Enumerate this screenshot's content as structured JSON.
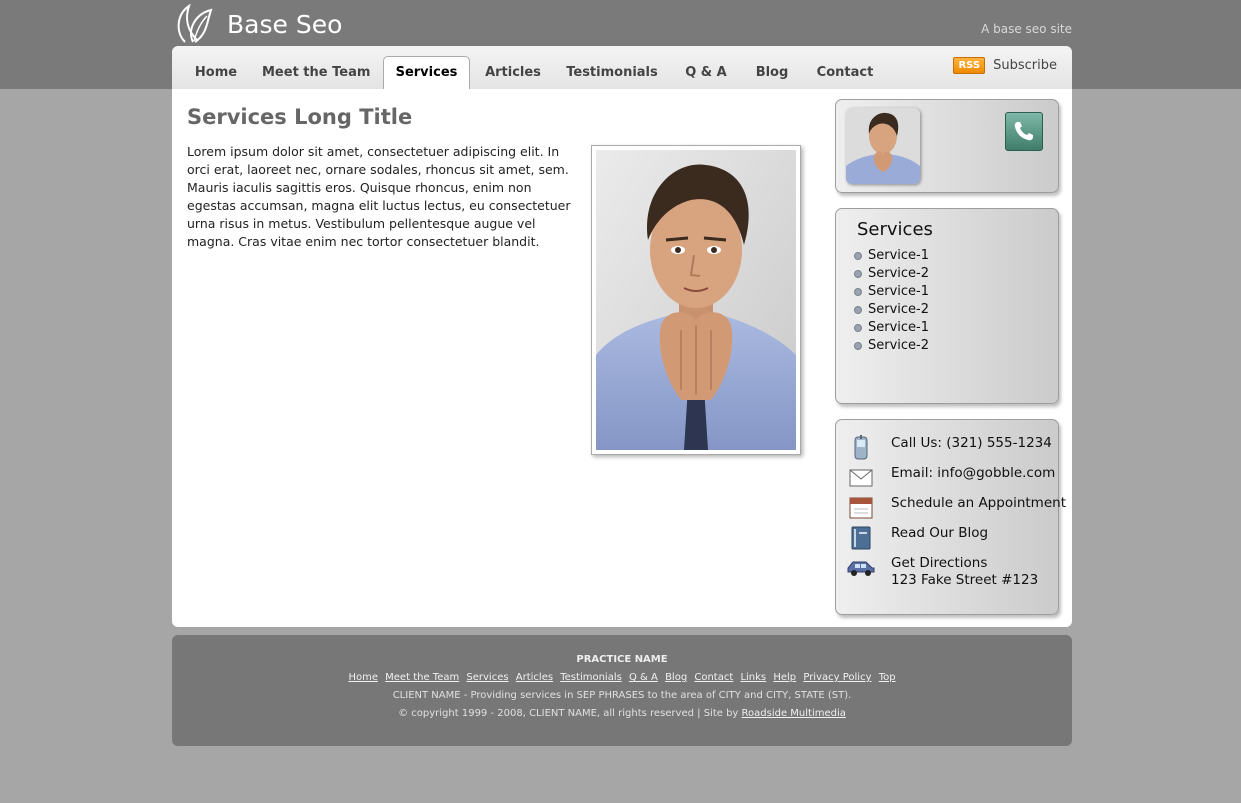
{
  "site": {
    "name": "Base Seo",
    "tagline": "A base seo site"
  },
  "nav": {
    "tabs": [
      {
        "label": "Home"
      },
      {
        "label": "Meet the Team"
      },
      {
        "label": "Services",
        "active": true
      },
      {
        "label": "Articles"
      },
      {
        "label": "Testimonials"
      },
      {
        "label": "Q & A"
      },
      {
        "label": "Blog"
      },
      {
        "label": "Contact"
      }
    ],
    "rss_badge": "RSS",
    "subscribe_label": "Subscribe"
  },
  "main": {
    "title": "Services Long Title",
    "body": "Lorem ipsum dolor sit amet, consectetuer adipiscing elit. In orci erat, laoreet nec, ornare sodales, rhoncus sit amet, sem. Mauris iaculis sagittis eros. Quisque rhoncus, enim non egestas accumsan, magna elit luctus lectus, eu consectetuer urna risus in metus. Vestibulum pellentesque augue vel magna. Cras vitae enim nec tortor consectetuer blandit."
  },
  "sidebar": {
    "services_title": "Services",
    "services": [
      "Service-1",
      "Service-2",
      "Service-1",
      "Service-2",
      "Service-1",
      "Service-2"
    ],
    "contact": {
      "call": "Call Us: (321) 555-1234",
      "email": "Email: info@gobble.com",
      "schedule": "Schedule an Appointment",
      "blog": "Read Our Blog",
      "directions": "Get Directions",
      "address": "123 Fake Street #123"
    }
  },
  "footer": {
    "practice_name": "PRACTICE NAME",
    "links": [
      "Home",
      "Meet the Team",
      "Services",
      "Articles",
      "Testimonials",
      "Q & A",
      "Blog",
      "Contact",
      "Links",
      "Help",
      "Privacy Policy",
      "Top"
    ],
    "line1": "CLIENT NAME - Providing services in SEP PHRASES to the area of CITY and CITY, STATE (ST).",
    "copyright": "© copyright 1999 - 2008, CLIENT NAME, all rights reserved | Site by ",
    "credit": "Roadside Multimedia"
  },
  "colors": {
    "header_bg": "#7a7a7a",
    "page_bg": "#a6a6a6",
    "footer_bg": "#777777",
    "rss_orange": "#f08a00"
  }
}
